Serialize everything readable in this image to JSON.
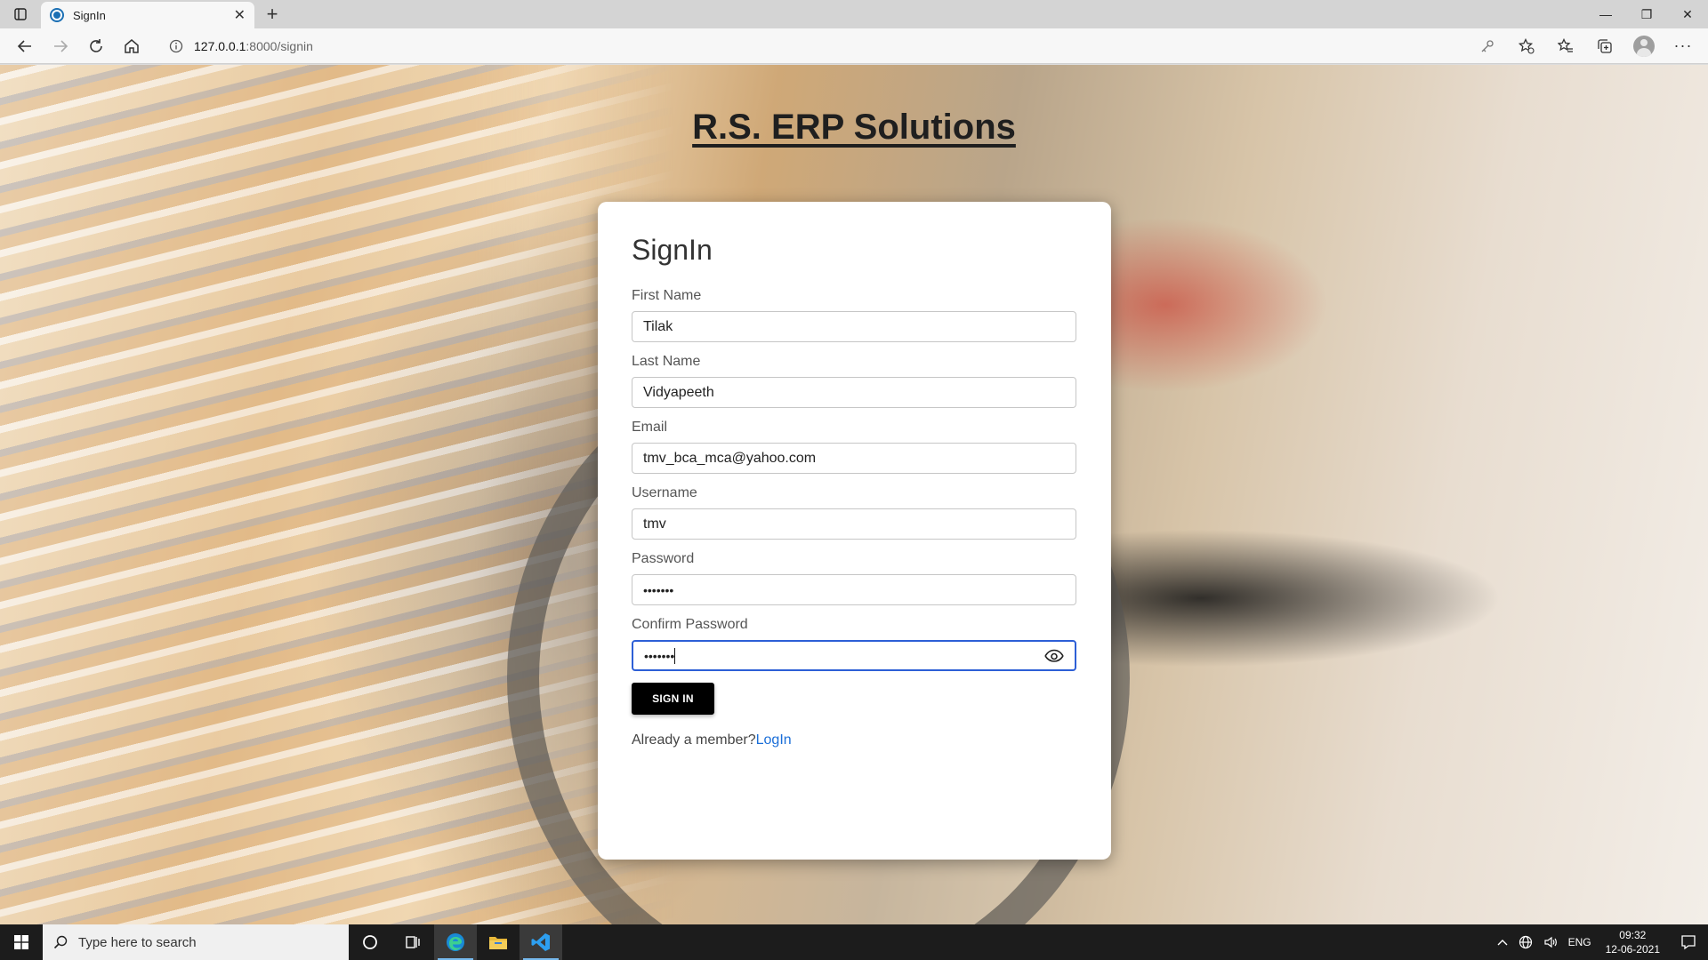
{
  "browser": {
    "tab_title": "SignIn",
    "url_host": "127.0.0.1",
    "url_path": ":8000/signin"
  },
  "page": {
    "brand": "R.S. ERP Solutions",
    "form": {
      "title": "SignIn",
      "first_name_label": "First Name",
      "first_name_value": "Tilak",
      "last_name_label": "Last Name",
      "last_name_value": "Vidyapeeth",
      "email_label": "Email",
      "email_value": "tmv_bca_mca@yahoo.com",
      "username_label": "Username",
      "username_value": "tmv",
      "password_label": "Password",
      "password_value": "•••••••",
      "confirm_password_label": "Confirm Password",
      "confirm_password_value": "•••••••",
      "submit_label": "SIGN IN",
      "member_text": "Already a member?",
      "login_link": "LogIn"
    }
  },
  "taskbar": {
    "search_placeholder": "Type here to search",
    "language": "ENG",
    "time": "09:32",
    "date": "12-06-2021"
  },
  "colors": {
    "accent_link": "#1a6ed8",
    "focus_border": "#2d5fd6",
    "button_bg": "#000000"
  }
}
